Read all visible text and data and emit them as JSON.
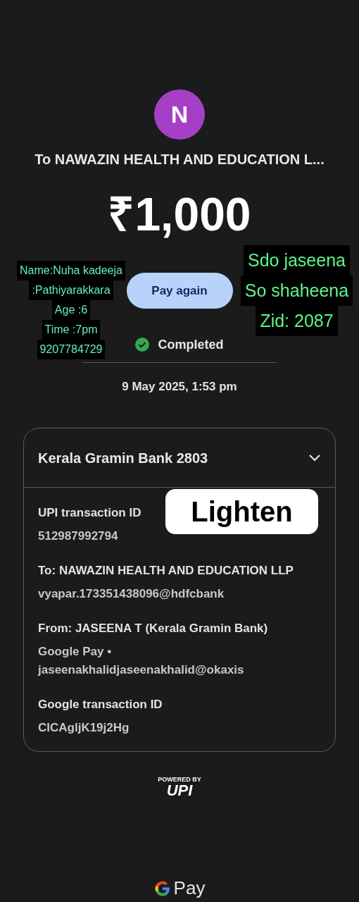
{
  "payee": {
    "initial": "N",
    "title": "To NAWAZIN HEALTH AND EDUCATION L..."
  },
  "amount": "₹1,000",
  "pay_again_button": "Pay again",
  "status": {
    "kind": "completed",
    "label": "Completed"
  },
  "date": "9 May 2025, 1:53 pm",
  "account": {
    "bank": "Kerala Gramin Bank 2803",
    "expanded": true
  },
  "details": [
    {
      "label": "UPI transaction ID",
      "value": "512987992794"
    },
    {
      "label": "To: NAWAZIN HEALTH AND EDUCATION LLP",
      "value": "vyapar.173351438096@hdfcbank"
    },
    {
      "label": "From: JASEENA T (Kerala Gramin Bank)",
      "value": "Google Pay • jaseenakhalidjaseenakhalid@okaxis"
    },
    {
      "label": "Google transaction ID",
      "value": "CICAgljK19j2Hg"
    }
  ],
  "upi_badge": {
    "powered_by": "POWERED BY",
    "logo": "UPI"
  },
  "footer_brand": "Pay",
  "overlays": {
    "left_note": [
      "Name:Nuha kadeeja",
      ":Pathiyarakkara",
      "Age :6",
      "Time :7pm",
      "9207784729"
    ],
    "right_note": [
      "Sdo jaseena",
      "So shaheena",
      "Zid: 2087"
    ],
    "sticker": "Lighten"
  }
}
